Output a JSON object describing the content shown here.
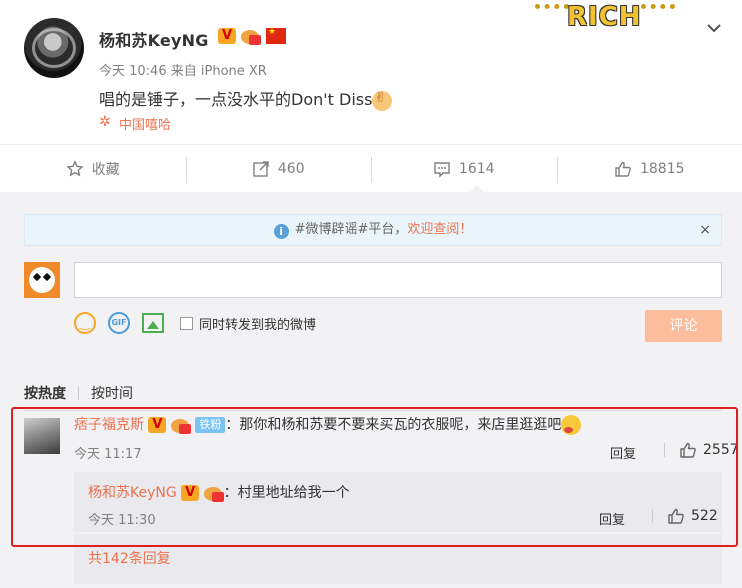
{
  "post": {
    "author": "杨和苏KeyNG",
    "badges": {
      "verified": "V"
    },
    "time": "今天 10:46",
    "source": "来自 iPhone XR",
    "text": "唱的是锤子，一点没水平的Don't Diss",
    "topic": "中国嘻哈",
    "decoration": "RICH"
  },
  "actions": {
    "favorite": "收藏",
    "repost_count": "460",
    "comment_count": "1614",
    "like_count": "18815"
  },
  "notice": {
    "prefix": "#微博辟谣#平台，",
    "highlight": "欢迎查阅！",
    "icon": "i",
    "close": "×"
  },
  "composer": {
    "gif_label": "GIF",
    "repost_label": "同时转发到我的微博",
    "submit_label": "评论"
  },
  "sort": {
    "hot": "按热度",
    "time": "按时间"
  },
  "comment": {
    "user": "痞子福克斯",
    "badges": {
      "verified": "V",
      "fan": "铁粉"
    },
    "text": "：那你和杨和苏要不要来买瓦的衣服呢，来店里逛逛吧",
    "time": "今天 11:17",
    "reply_label": "回复",
    "likes": "2557"
  },
  "sub_reply": {
    "user": "杨和苏KeyNG",
    "badges": {
      "verified": "V"
    },
    "text": "：村里地址给我一个",
    "time": "今天 11:30",
    "reply_label": "回复",
    "likes": "522"
  },
  "more_replies": "共142条回复",
  "colors": {
    "accent": "#eb7350",
    "highlight_border": "#e02020",
    "comment_bg": "#f2f2f5",
    "submit_disabled": "#fbbd9b"
  },
  "icons": [
    "star-icon",
    "repost-icon",
    "comment-icon",
    "like-icon",
    "chevron-down-icon",
    "info-icon",
    "close-icon",
    "emoji-icon",
    "gif-icon",
    "image-icon",
    "topic-icon"
  ]
}
